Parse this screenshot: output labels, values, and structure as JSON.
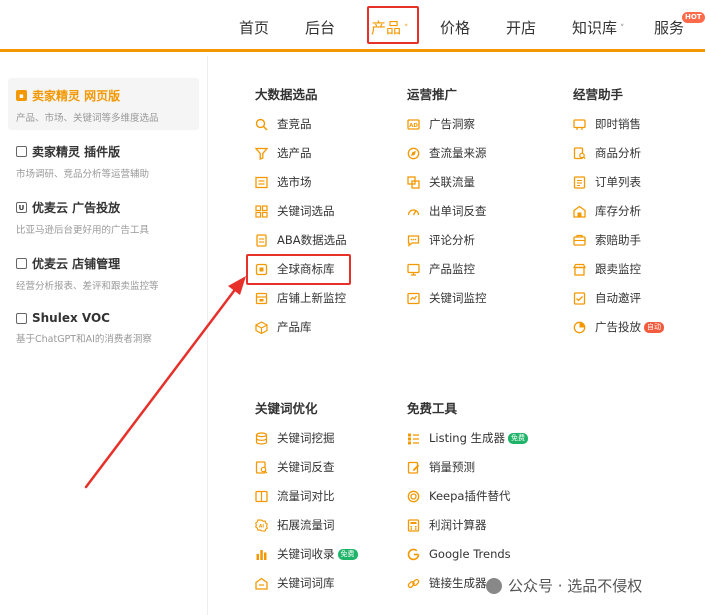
{
  "nav": {
    "items": [
      {
        "label": "首页"
      },
      {
        "label": "后台"
      },
      {
        "label": "产品",
        "chevron": "˅"
      },
      {
        "label": "价格"
      },
      {
        "label": "开店"
      },
      {
        "label": "知识库",
        "chevron": "˅"
      },
      {
        "label": "服务"
      }
    ],
    "hot_badge": "HOT",
    "accent": "#f39800"
  },
  "sidebar": {
    "items": [
      {
        "title": "卖家精灵 网页版",
        "desc": "产品、市场、关键词等多维度选品",
        "icon": "web-icon"
      },
      {
        "title": "卖家精灵 插件版",
        "desc": "市场调研、竞品分析等运营辅助",
        "icon": "plugin-icon"
      },
      {
        "title": "优麦云 广告投放",
        "desc": "比亚马逊后台更好用的广告工具",
        "icon": "ads-icon"
      },
      {
        "title": "优麦云 店铺管理",
        "desc": "经营分析报表、差评和跟卖监控等",
        "icon": "store-icon"
      },
      {
        "title": "Shulex VOC",
        "desc": "基于ChatGPT和AI的消费者洞察",
        "icon": "voc-icon"
      }
    ]
  },
  "columns": {
    "big_data": {
      "title": "大数据选品",
      "items": [
        "查竞品",
        "选产品",
        "选市场",
        "关键词选品",
        "ABA数据选品",
        "全球商标库",
        "店铺上新监控",
        "产品库"
      ]
    },
    "operations": {
      "title": "运营推广",
      "items": [
        "广告洞察",
        "查流量来源",
        "关联流量",
        "出单词反查",
        "评论分析",
        "产品监控",
        "关键词监控"
      ]
    },
    "assistant": {
      "title": "经营助手",
      "items": [
        "即时销售",
        "商品分析",
        "订单列表",
        "库存分析",
        "索赔助手",
        "跟卖监控",
        "自动邀评",
        "广告投放"
      ],
      "ads_tag": "自动"
    },
    "keyword_opt": {
      "title": "关键词优化",
      "items": [
        "关键词挖掘",
        "关键词反查",
        "流量词对比",
        "拓展流量词",
        "关键词收录",
        "关键词词库"
      ],
      "free_tag": "免费"
    },
    "free_tools": {
      "title": "免费工具",
      "items": [
        "Listing 生成器",
        "销量预测",
        "Keepa插件替代",
        "利润计算器",
        "Google Trends",
        "链接生成器"
      ],
      "free_tag": "免费"
    }
  },
  "watermark": "公众号 · 选品不侵权"
}
